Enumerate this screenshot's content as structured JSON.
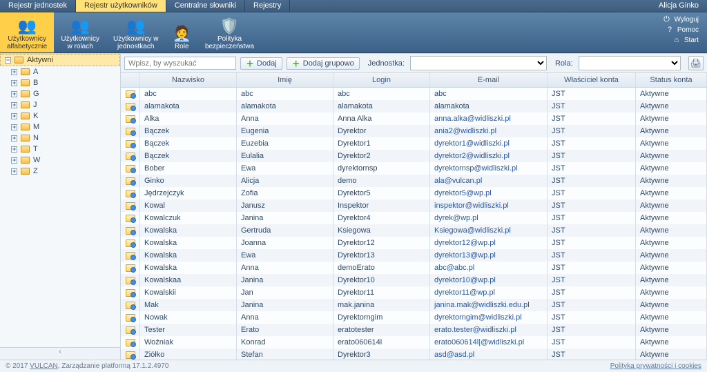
{
  "topbar": {
    "tabs": [
      {
        "label": "Rejestr jednostek"
      },
      {
        "label": "Rejestr użytkowników"
      },
      {
        "label": "Centralne słowniki"
      },
      {
        "label": "Rejestry"
      }
    ],
    "user": "Alicja Ginko"
  },
  "ribbon": {
    "items": [
      {
        "label": "Użytkownicy\nalfabetycznie"
      },
      {
        "label": "Użytkownicy\nw rolach"
      },
      {
        "label": "Użytkownicy w\njednostkach"
      },
      {
        "label": "Role"
      },
      {
        "label": "Polityka\nbezpieczeństwa"
      }
    ],
    "right": {
      "logout": "Wyloguj",
      "help": "Pomoc",
      "start": "Start"
    }
  },
  "tree": {
    "root": "Aktywni",
    "nodes": [
      "A",
      "B",
      "G",
      "J",
      "K",
      "M",
      "N",
      "T",
      "W",
      "Z"
    ]
  },
  "toolbar": {
    "search_placeholder": "Wpisz, by wyszukać",
    "add_label": "Dodaj",
    "add_group_label": "Dodaj grupowo",
    "unit_label": "Jednostka:",
    "role_label": "Rola:"
  },
  "grid": {
    "columns": {
      "nazwisko": "Nazwisko",
      "imie": "Imię",
      "login": "Login",
      "email": "E-mail",
      "wlasciciel": "Właściciel konta",
      "status": "Status konta"
    },
    "rows": [
      {
        "nazwisko": "abc",
        "imie": "abc",
        "login": "abc",
        "email": "abc",
        "wlasc": "JST",
        "status": "Aktywne",
        "is_link": false
      },
      {
        "nazwisko": "alamakota",
        "imie": "alamakota",
        "login": "alamakota",
        "email": "alamakota",
        "wlasc": "JST",
        "status": "Aktywne",
        "is_link": false
      },
      {
        "nazwisko": "Alka",
        "imie": "Anna",
        "login": "Anna Alka",
        "email": "anna.alka@widliszki.pl",
        "wlasc": "JST",
        "status": "Aktywne",
        "is_link": true
      },
      {
        "nazwisko": "Bączek",
        "imie": "Eugenia",
        "login": "Dyrektor",
        "email": "ania2@widliszki.pl",
        "wlasc": "JST",
        "status": "Aktywne",
        "is_link": true
      },
      {
        "nazwisko": "Bączek",
        "imie": "Euzebia",
        "login": "Dyrektor1",
        "email": "dyrektor1@widliszki.pl",
        "wlasc": "JST",
        "status": "Aktywne",
        "is_link": true
      },
      {
        "nazwisko": "Bączek",
        "imie": "Eulalia",
        "login": "Dyrektor2",
        "email": "dyrektor2@widliszki.pl",
        "wlasc": "JST",
        "status": "Aktywne",
        "is_link": true
      },
      {
        "nazwisko": "Bober",
        "imie": "Ewa",
        "login": "dyrektornsp",
        "email": "dyrektornsp@widliszki.pl",
        "wlasc": "JST",
        "status": "Aktywne",
        "is_link": true
      },
      {
        "nazwisko": "Ginko",
        "imie": "Alicja",
        "login": "demo",
        "email": "ala@vulcan.pl",
        "wlasc": "JST",
        "status": "Aktywne",
        "is_link": true
      },
      {
        "nazwisko": "Jędrzejczyk",
        "imie": "Zofia",
        "login": "Dyrektor5",
        "email": "dyrektor5@wp.pl",
        "wlasc": "JST",
        "status": "Aktywne",
        "is_link": true
      },
      {
        "nazwisko": "Kowal",
        "imie": "Janusz",
        "login": "Inspektor",
        "email": "inspektor@widliszki.pl",
        "wlasc": "JST",
        "status": "Aktywne",
        "is_link": true
      },
      {
        "nazwisko": "Kowalczuk",
        "imie": "Janina",
        "login": "Dyrektor4",
        "email": "dyrek@wp.pl",
        "wlasc": "JST",
        "status": "Aktywne",
        "is_link": true
      },
      {
        "nazwisko": "Kowalska",
        "imie": "Gertruda",
        "login": "Ksiegowa",
        "email": "Ksiegowa@widliszki.pl",
        "wlasc": "JST",
        "status": "Aktywne",
        "is_link": true
      },
      {
        "nazwisko": "Kowalska",
        "imie": "Joanna",
        "login": "Dyrektor12",
        "email": "dyrektor12@wp.pl",
        "wlasc": "JST",
        "status": "Aktywne",
        "is_link": true
      },
      {
        "nazwisko": "Kowalska",
        "imie": "Ewa",
        "login": "Dyrektor13",
        "email": "dyrektor13@wp.pl",
        "wlasc": "JST",
        "status": "Aktywne",
        "is_link": true
      },
      {
        "nazwisko": "Kowalska",
        "imie": "Anna",
        "login": "demoErato",
        "email": "abc@abc.pl",
        "wlasc": "JST",
        "status": "Aktywne",
        "is_link": true
      },
      {
        "nazwisko": "Kowalskaa",
        "imie": "Janina",
        "login": "Dyrektor10",
        "email": "dyrektor10@wp.pl",
        "wlasc": "JST",
        "status": "Aktywne",
        "is_link": true
      },
      {
        "nazwisko": "Kowalskii",
        "imie": "Jan",
        "login": "Dyrektor11",
        "email": "dyrektor11@wp.pl",
        "wlasc": "JST",
        "status": "Aktywne",
        "is_link": true
      },
      {
        "nazwisko": "Mak",
        "imie": "Janina",
        "login": "mak.janina",
        "email": "janina.mak@widliszki.edu.pl",
        "wlasc": "JST",
        "status": "Aktywne",
        "is_link": true
      },
      {
        "nazwisko": "Nowak",
        "imie": "Anna",
        "login": "Dyrektorngim",
        "email": "dyrektorngim@widliszki.pl",
        "wlasc": "JST",
        "status": "Aktywne",
        "is_link": true
      },
      {
        "nazwisko": "Tester",
        "imie": "Erato",
        "login": "eratotester",
        "email": "erato.tester@widliszki.pl",
        "wlasc": "JST",
        "status": "Aktywne",
        "is_link": true
      },
      {
        "nazwisko": "Woźniak",
        "imie": "Konrad",
        "login": "erato060614l",
        "email": "erato060614l|@widliszki.pl",
        "wlasc": "JST",
        "status": "Aktywne",
        "is_link": true
      },
      {
        "nazwisko": "Ziółko",
        "imie": "Stefan",
        "login": "Dyrektor3",
        "email": "asd@asd.pl",
        "wlasc": "JST",
        "status": "Aktywne",
        "is_link": true
      }
    ]
  },
  "footer": {
    "copyright_prefix": "© 2017 ",
    "vendor": "VULCAN",
    "copyright_suffix": ", Zarządzanie platformą 17.1.2.4970",
    "privacy": "Polityka prywatności i cookies"
  }
}
